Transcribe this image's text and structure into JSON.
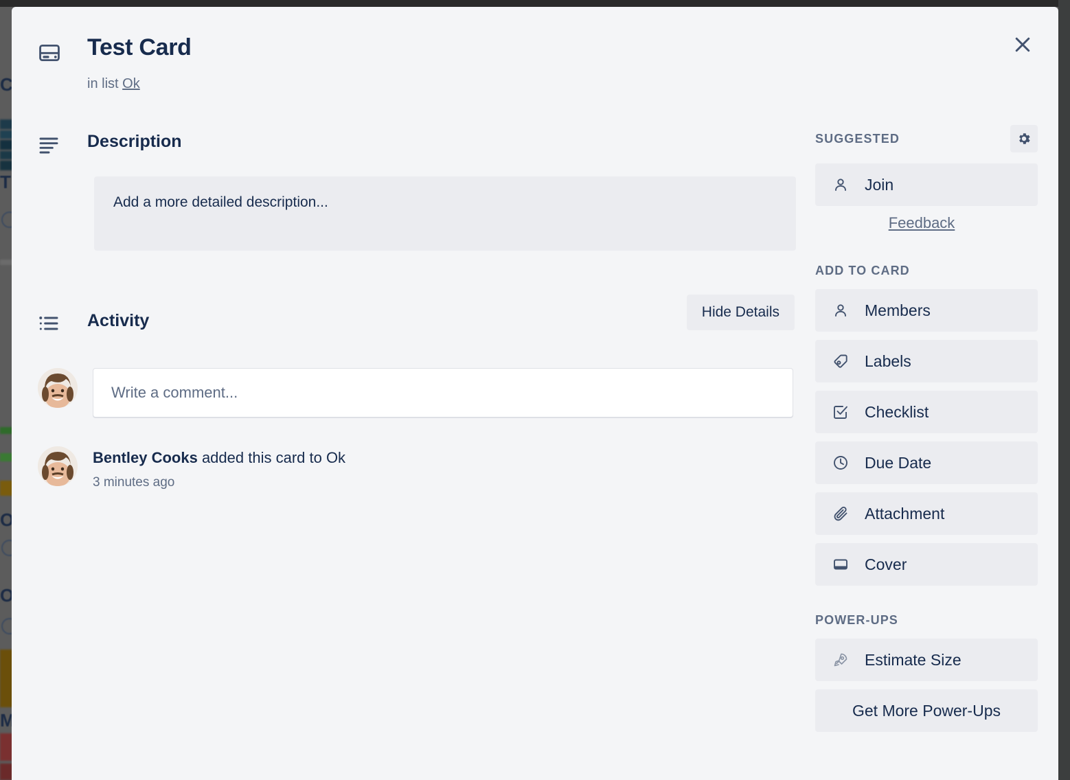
{
  "backdrop": {
    "board_hint_letters": [
      "C",
      "T",
      "O",
      "O",
      "M"
    ],
    "card_colors": [
      "#1d3a4a",
      "#1f4152",
      "#14303f",
      "#1b3947",
      "#2f6b2a",
      "#3a7a33",
      "#7a5c0d",
      "#6b4f0a",
      "#7a2f2f",
      "#6b2a2a"
    ]
  },
  "header": {
    "icon": "card-icon",
    "title": "Test Card",
    "in_list_prefix": "in list",
    "list_name": "Ok",
    "close_icon": "close-icon"
  },
  "description": {
    "icon": "description-lines-icon",
    "title": "Description",
    "placeholder": "Add a more detailed description..."
  },
  "activity": {
    "icon": "activity-list-icon",
    "title": "Activity",
    "hide_details_label": "Hide Details",
    "comment_placeholder": "Write a comment...",
    "entries": [
      {
        "member": "Bentley Cooks",
        "action": " added this card to Ok",
        "time": "3 minutes ago"
      }
    ]
  },
  "sidebar": {
    "suggested": {
      "heading": "SUGGESTED",
      "settings_icon": "gear-icon",
      "items": [
        {
          "label": "Join",
          "icon": "person-icon"
        }
      ],
      "feedback_label": "Feedback"
    },
    "add_to_card": {
      "heading": "ADD TO CARD",
      "items": [
        {
          "label": "Members",
          "icon": "person-icon"
        },
        {
          "label": "Labels",
          "icon": "tag-icon"
        },
        {
          "label": "Checklist",
          "icon": "checkbox-icon"
        },
        {
          "label": "Due Date",
          "icon": "clock-icon"
        },
        {
          "label": "Attachment",
          "icon": "paperclip-icon"
        },
        {
          "label": "Cover",
          "icon": "cover-icon"
        }
      ]
    },
    "power_ups": {
      "heading": "POWER-UPS",
      "items": [
        {
          "label": "Estimate Size",
          "icon": "rocket-icon"
        }
      ],
      "get_more_label": "Get More Power-Ups"
    }
  },
  "colors": {
    "modal_bg": "#f4f5f7",
    "button_bg": "#ebecf0",
    "text_primary": "#172b4d",
    "text_muted": "#5e6c84",
    "backdrop": "#5c5c5c"
  }
}
